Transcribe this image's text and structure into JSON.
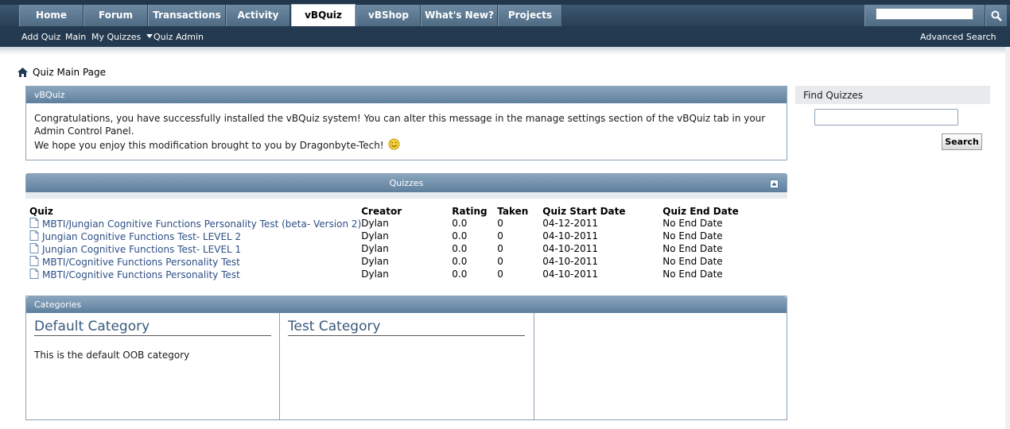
{
  "nav": {
    "tabs": [
      {
        "label": "Home"
      },
      {
        "label": "Forum"
      },
      {
        "label": "Transactions"
      },
      {
        "label": "Activity"
      },
      {
        "label": "vBQuiz"
      },
      {
        "label": "vBShop"
      },
      {
        "label": "What's New?"
      },
      {
        "label": "Projects"
      }
    ],
    "selected_tab": "vBQuiz",
    "search_placeholder": ""
  },
  "subnav": {
    "items": [
      "Add Quiz",
      "Main",
      "My Quizzes",
      "Quiz Admin"
    ],
    "advanced_search": "Advanced Search"
  },
  "breadcrumb": {
    "current": "Quiz Main Page"
  },
  "welcome": {
    "title": "vBQuiz",
    "line1": "Congratulations, you have successfully installed the vBQuiz system! You can alter this message in the manage settings section of the vBQuiz tab in your Admin Control Panel.",
    "line2": "We hope you enjoy this modification brought to you by Dragonbyte-Tech!"
  },
  "quizzes": {
    "title": "Quizzes",
    "columns": [
      "Quiz",
      "Creator",
      "Rating",
      "Taken",
      "Quiz Start Date",
      "Quiz End Date"
    ],
    "rows": [
      {
        "quiz": "MBTI/Jungian Cognitive Functions Personality Test (beta- Version 2)",
        "creator": "Dylan",
        "rating": "0.0",
        "taken": "0",
        "start": "04-12-2011",
        "end": "No End Date"
      },
      {
        "quiz": "Jungian Cognitive Functions Test- LEVEL 2",
        "creator": "Dylan",
        "rating": "0.0",
        "taken": "0",
        "start": "04-10-2011",
        "end": "No End Date"
      },
      {
        "quiz": "Jungian Cognitive Functions Test- LEVEL 1",
        "creator": "Dylan",
        "rating": "0.0",
        "taken": "0",
        "start": "04-10-2011",
        "end": "No End Date"
      },
      {
        "quiz": "MBTI/Cognitive Functions Personality Test",
        "creator": "Dylan",
        "rating": "0.0",
        "taken": "0",
        "start": "04-10-2011",
        "end": "No End Date"
      },
      {
        "quiz": "MBTI/Cognitive Functions Personality Test",
        "creator": "Dylan",
        "rating": "0.0",
        "taken": "0",
        "start": "04-10-2011",
        "end": "No End Date"
      }
    ]
  },
  "categories": {
    "title": "Categories",
    "items": [
      {
        "name": "Default Category",
        "description": "This is the default OOB category"
      },
      {
        "name": "Test Category",
        "description": ""
      }
    ]
  },
  "sidebar": {
    "find_title": "Find Quizzes",
    "search_button": "Search"
  },
  "icons": [
    "home-icon",
    "magnifier-icon",
    "dropdown-arrow-icon",
    "smiley-icon",
    "document-icon",
    "collapse-icon"
  ],
  "colors": {
    "nav_dark": "#243a50",
    "link": "#2d4f86",
    "creator": "#cc0000",
    "block_head": "#6f8eaa"
  }
}
